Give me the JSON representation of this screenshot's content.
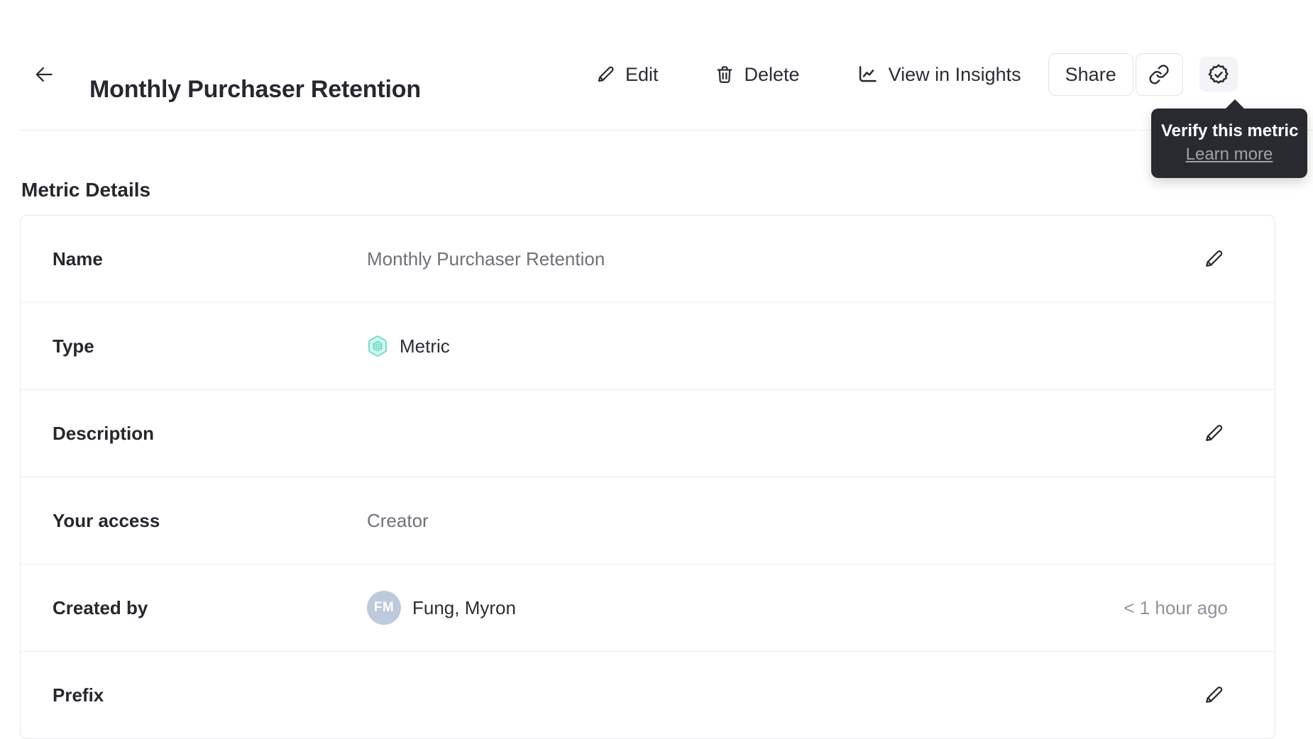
{
  "header": {
    "title": "Monthly Purchaser Retention",
    "actions": {
      "edit": "Edit",
      "delete": "Delete",
      "insights": "View in Insights",
      "share": "Share"
    }
  },
  "tooltip": {
    "title": "Verify this metric",
    "link": "Learn more"
  },
  "section_title": "Metric Details",
  "details": {
    "name": {
      "label": "Name",
      "value": "Monthly Purchaser Retention"
    },
    "type": {
      "label": "Type",
      "value": "Metric"
    },
    "description": {
      "label": "Description",
      "value": ""
    },
    "access": {
      "label": "Your access",
      "value": "Creator"
    },
    "created_by": {
      "label": "Created by",
      "value": "Fung, Myron",
      "avatar_initials": "FM",
      "timestamp": "< 1 hour ago"
    },
    "prefix": {
      "label": "Prefix",
      "value": ""
    }
  },
  "colors": {
    "accent_teal": "#5bdcc8",
    "teal_fill": "#d9f6f0",
    "tooltip_bg": "#282a30",
    "text_dark": "#2b2d33",
    "text_gray": "#6e7177",
    "text_light_gray": "#8f939b",
    "avatar_bg": "#bccadb",
    "card_border": "#e7e7ea",
    "divider": "#ececee",
    "verify_button_bg": "#f4f4f7"
  }
}
